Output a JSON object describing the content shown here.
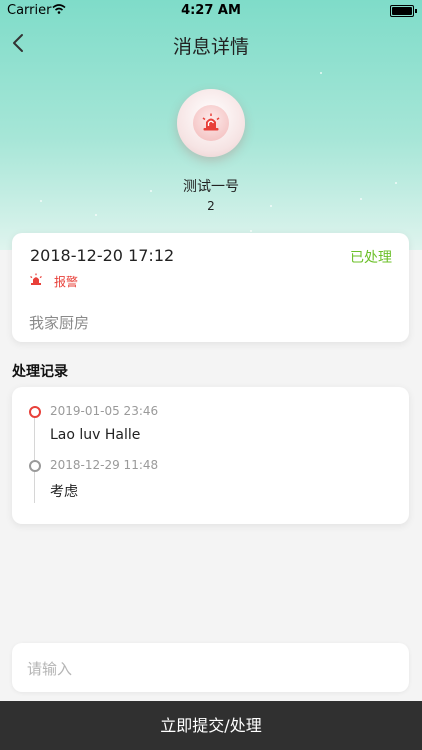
{
  "status_bar": {
    "carrier": "Carrier",
    "time": "4:27 AM"
  },
  "nav": {
    "title": "消息详情"
  },
  "device": {
    "name": "测试一号",
    "number": "2",
    "icon": "alarm-siren-icon"
  },
  "message": {
    "time": "2018-12-20 17:12",
    "status": "已处理",
    "type": "报警",
    "location": "我家厨房"
  },
  "records": {
    "title": "处理记录",
    "items": [
      {
        "time": "2019-01-05 23:46",
        "text": "Lao luv Halle"
      },
      {
        "time": "2018-12-29 11:48",
        "text": "考虑"
      }
    ]
  },
  "input": {
    "placeholder": "请输入"
  },
  "submit_label": "立即提交/处理",
  "colors": {
    "accent_green": "#6cc02a",
    "alarm_red": "#e8403a",
    "bar_dark": "#303030"
  }
}
